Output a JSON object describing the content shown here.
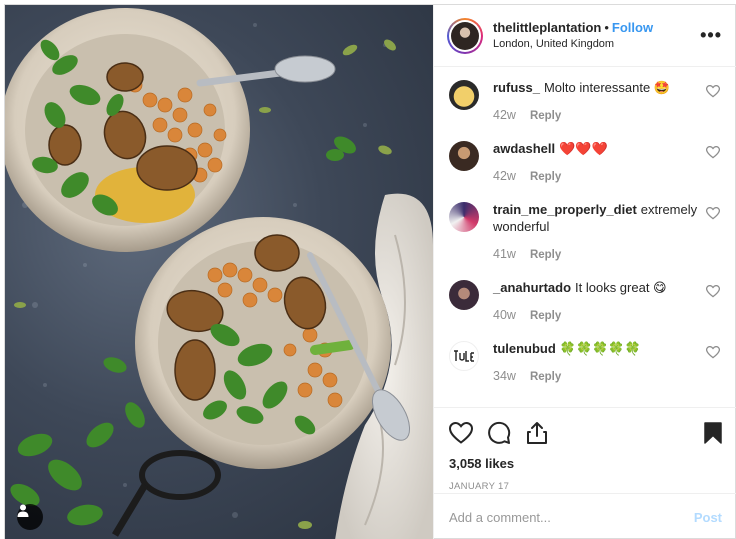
{
  "post": {
    "username": "thelittleplantation",
    "follow_label": "Follow",
    "separator": "•",
    "location": "London, United Kingdom",
    "more_label": "•••",
    "likes": "3,058 likes",
    "date": "JANUARY 17"
  },
  "comments": [
    {
      "user": "rufuss_",
      "text": "Molto interessante 🤩",
      "time": "42w",
      "reply": "Reply",
      "avatar_color": "#e9c56a"
    },
    {
      "user": "awdashell",
      "text": "❤️❤️❤️",
      "time": "42w",
      "reply": "Reply",
      "avatar_color": "#7a5a3e"
    },
    {
      "user": "train_me_properly_diet",
      "text": "extremely wonderful",
      "time": "41w",
      "reply": "Reply",
      "avatar_color": "#5a4a7a"
    },
    {
      "user": "_anahurtado",
      "text": "It looks great 😋",
      "time": "40w",
      "reply": "Reply",
      "avatar_color": "#4a3a48"
    },
    {
      "user": "tulenubud",
      "text": "🍀🍀🍀🍀🍀",
      "time": "34w",
      "reply": "Reply",
      "avatar_color": "#ffffff"
    }
  ],
  "comment_box": {
    "placeholder": "Add a comment...",
    "post_label": "Post"
  },
  "colors": {
    "link": "#3897f0",
    "muted": "#8e8e8e",
    "text": "#262626",
    "post_disabled": "#b3dbff"
  },
  "icons": [
    "heart-icon",
    "comment-icon",
    "share-icon",
    "bookmark-icon",
    "more-icon",
    "user-tag-icon"
  ]
}
